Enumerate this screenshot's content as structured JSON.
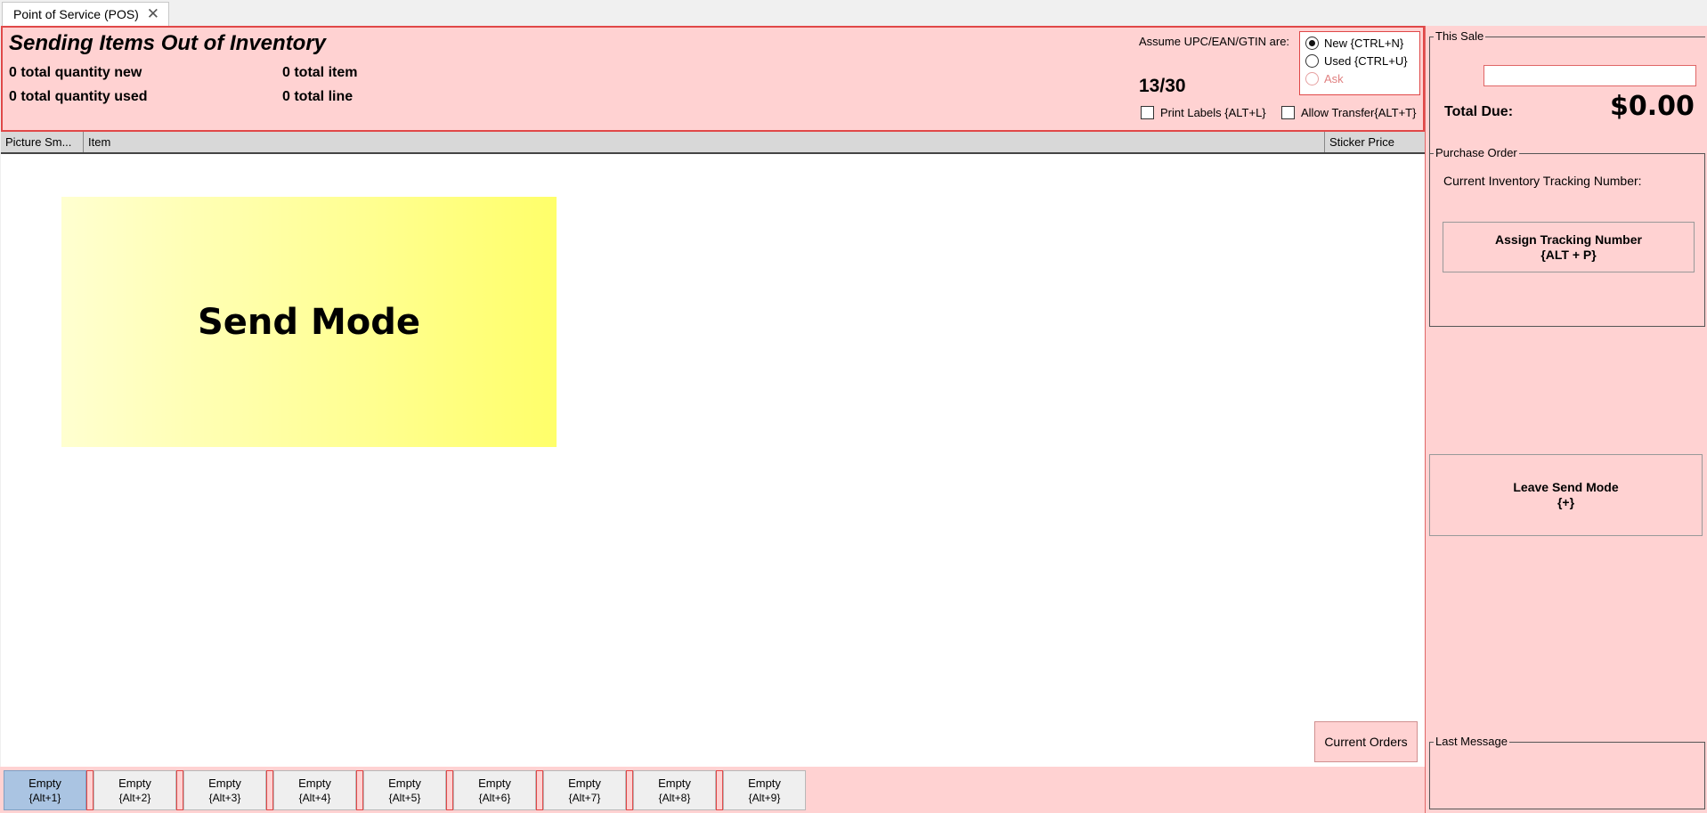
{
  "tab": {
    "label": "Point of Service (POS)",
    "close_glyph": "✕"
  },
  "header": {
    "title": "Sending Items Out of Inventory",
    "stats": {
      "qty_new": "0 total quantity new",
      "qty_used": "0 total quantity used",
      "total_item": "0 total item",
      "total_line": "0 total line"
    },
    "assume_label": "Assume UPC/EAN/GTIN are:",
    "count": "13/30",
    "radio": {
      "new": "New {CTRL+N}",
      "used": "Used {CTRL+U}",
      "ask": "Ask",
      "selected": "new"
    },
    "print_labels": "Print Labels {ALT+L}",
    "allow_transfer": "Allow Transfer{ALT+T}"
  },
  "grid": {
    "columns": [
      "Picture Sm...",
      "Item",
      "Sticker Price"
    ]
  },
  "send_mode_label": "Send Mode",
  "current_orders_label": "Current Orders",
  "hotkeys": [
    {
      "label": "Empty",
      "key": "{Alt+1}"
    },
    {
      "label": "Empty",
      "key": "{Alt+2}"
    },
    {
      "label": "Empty",
      "key": "{Alt+3}"
    },
    {
      "label": "Empty",
      "key": "{Alt+4}"
    },
    {
      "label": "Empty",
      "key": "{Alt+5}"
    },
    {
      "label": "Empty",
      "key": "{Alt+6}"
    },
    {
      "label": "Empty",
      "key": "{Alt+7}"
    },
    {
      "label": "Empty",
      "key": "{Alt+8}"
    },
    {
      "label": "Empty",
      "key": "{Alt+9}"
    }
  ],
  "this_sale": {
    "title": "This Sale",
    "input_value": "",
    "total_label": "Total Due:",
    "total_value": "$0.00"
  },
  "purchase_order": {
    "title": "Purchase Order",
    "tracking_label": "Current Inventory Tracking Number:",
    "assign_line1": "Assign Tracking Number",
    "assign_line2": "{ALT + P}"
  },
  "leave_send": {
    "line1": "Leave Send Mode",
    "line2": "{+}"
  },
  "last_message": {
    "title": "Last Message"
  },
  "colors": {
    "panel_bg": "#ffd2d2",
    "panel_border": "#e04848",
    "active_hotkey": "#aac4e2",
    "send_mode_gradient_start": "#ffffd0",
    "send_mode_gradient_end": "#ffff6a"
  }
}
